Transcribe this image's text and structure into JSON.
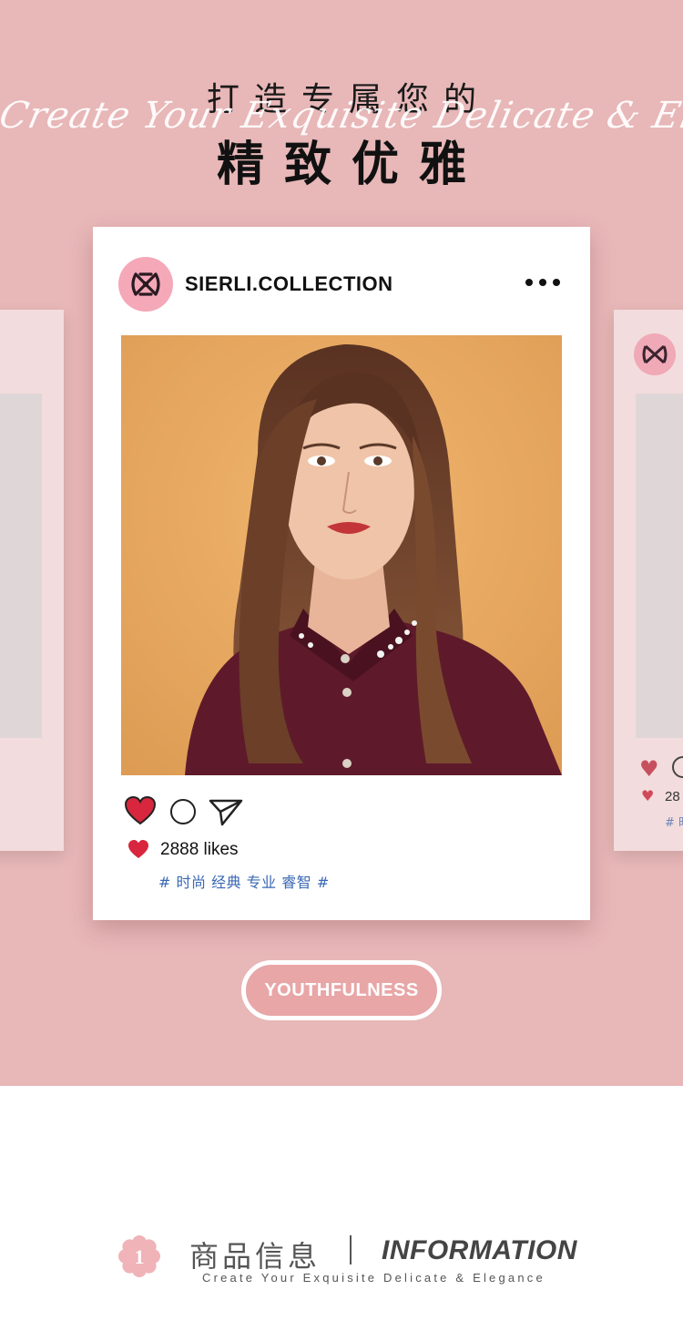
{
  "hero": {
    "headline_top": "打造专属您的",
    "script_line": "Create Your Exquisite Delicate & Elegance",
    "headline_main": "精致优雅",
    "background_color": "#e8b7b8"
  },
  "post": {
    "username": "SIERLI.COLLECTION",
    "likes_text": "2888 likes",
    "tags": "# 时尚 经典 专业 睿智 #",
    "like_color": "#d7263d"
  },
  "side_card": {
    "likes_text": "28",
    "tag": "# 时"
  },
  "badge": {
    "label": "YOUTHFULNESS"
  },
  "info": {
    "number": "1",
    "title_cn": "商品信息",
    "title_en": "INFORMATION",
    "subtitle": "Create Your Exquisite Delicate & Elegance"
  }
}
